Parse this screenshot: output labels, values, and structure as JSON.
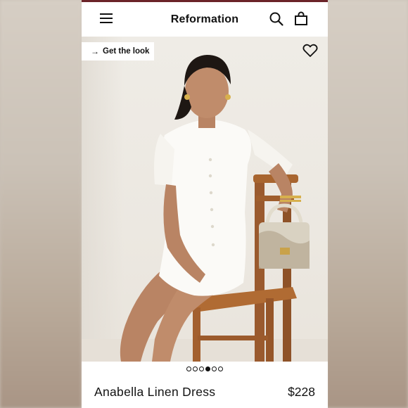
{
  "header": {
    "brand": "Reformation"
  },
  "overlay": {
    "get_the_look": "Get the look"
  },
  "carousel": {
    "total": 6,
    "active_index": 3
  },
  "product": {
    "name": "Anabella Linen Dress",
    "price": "$228"
  },
  "icons": {
    "menu": "hamburger-menu-icon",
    "search": "search-icon",
    "bag": "shopping-bag-icon",
    "favorite": "heart-icon",
    "arrow": "arrow-right-icon"
  },
  "colors": {
    "accent_bar": "#6b2328",
    "text": "#111111"
  }
}
